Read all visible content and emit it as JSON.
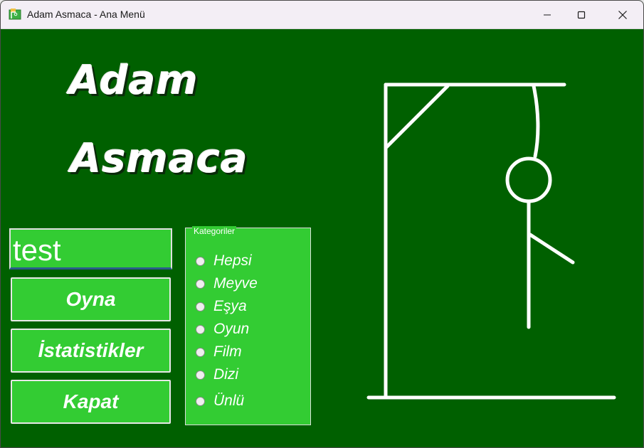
{
  "window": {
    "title": "Adam Asmaca - Ana Menü"
  },
  "logo": {
    "line1": "Adam",
    "line2": "Asmaca"
  },
  "name_input": {
    "value": "test"
  },
  "buttons": {
    "play": "Oyna",
    "stats": "İstatistikler",
    "close": "Kapat"
  },
  "categories": {
    "title": "Kategoriler",
    "options": [
      "Hepsi",
      "Meyve",
      "Eşya",
      "Oyun",
      "Film",
      "Dizi",
      "Ünlü"
    ]
  },
  "colors": {
    "background": "#006000",
    "accent": "#33cc33",
    "text": "#ffffff"
  }
}
